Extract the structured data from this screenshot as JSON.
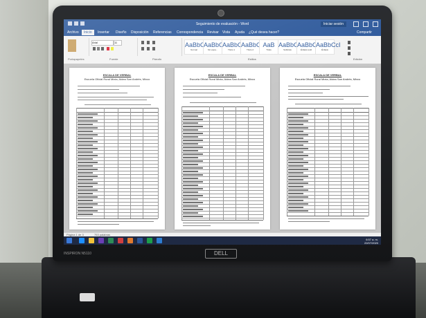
{
  "window": {
    "title": "Seguimiento de evaluación - Word",
    "login_label": "Iniciar sesión",
    "tabs": [
      "Archivo",
      "Inicio",
      "Insertar",
      "Diseño",
      "Disposición",
      "Referencias",
      "Correspondencia",
      "Revisar",
      "Vista",
      "Ayuda",
      "¿Qué desea hacer?"
    ],
    "share_label": "Compartir"
  },
  "ribbon": {
    "groups": [
      "Portapapeles",
      "Fuente",
      "Párrafo",
      "Estilos",
      "Edición"
    ],
    "font_name": "Arial",
    "font_size": "11",
    "styles": [
      {
        "preview": "AaBbCcI",
        "name": "Normal"
      },
      {
        "preview": "AaBbCcI",
        "name": "Sin espa..."
      },
      {
        "preview": "AaBbCc",
        "name": "Título 1"
      },
      {
        "preview": "AaBbCc",
        "name": "Título 2"
      },
      {
        "preview": "AaB",
        "name": "Título"
      },
      {
        "preview": "AaBbCcI",
        "name": "Subtítulo"
      },
      {
        "preview": "AaBbCcI",
        "name": "Énfasis sutil"
      },
      {
        "preview": "AaBbCcI",
        "name": "Énfasis"
      }
    ]
  },
  "pages": [
    {
      "heading": "ESCALA DE VERBAL",
      "subheading": "Escuela Oficial Rural Mixta, Aldea San Andrés, Mixco"
    },
    {
      "heading": "ESCALA DE VERBAL",
      "subheading": "Escuela Oficial Rural Mixta, Aldea San Andrés, Mixco"
    },
    {
      "heading": "ESCALA DE VERBAL",
      "subheading": "Escuela Oficial Rural Mixta, Aldea San Andrés, Mixco"
    }
  ],
  "statusbar": {
    "page": "Página 1 de 3",
    "words": "753 palabras"
  },
  "taskbar": {
    "time": "6:57 a. m.",
    "date": "22/07/2020"
  },
  "device": {
    "brand": "DELL",
    "model": "INSPIRON N5110"
  }
}
